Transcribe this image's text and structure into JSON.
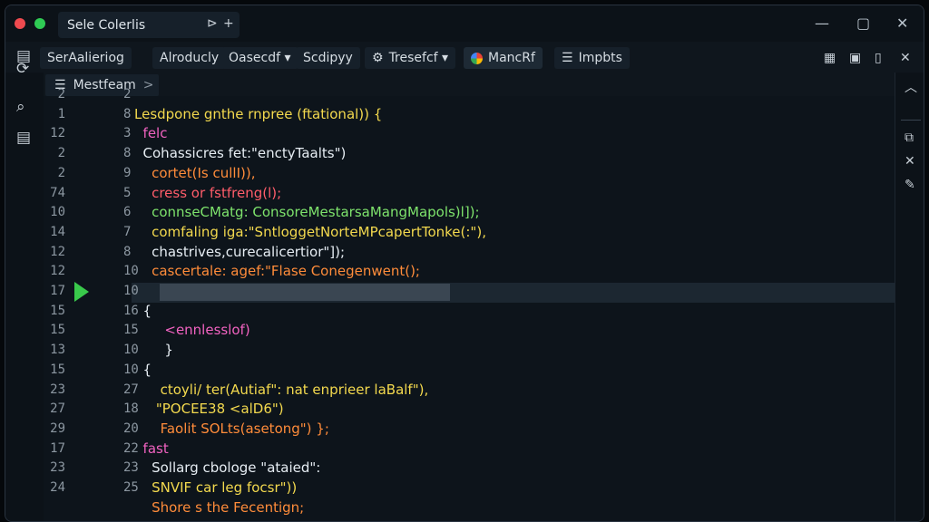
{
  "title_bar": {
    "tab_label": "Sele Colerlis",
    "tab_actions": [
      "⊳",
      "+"
    ],
    "window_controls": [
      "minimize-icon",
      "restore-icon",
      "close-icon"
    ]
  },
  "toolbar": {
    "items": [
      {
        "label": "SerAalieriog",
        "icon": "sidebar-icon"
      },
      {
        "label": "Alroducly"
      },
      {
        "label": "Oasecdf ▾"
      },
      {
        "label": "Scdipyy"
      },
      {
        "label": "Tresefcf ▾",
        "icon": "settings-icon"
      },
      {
        "label": "MancRf",
        "icon": "google-icon",
        "active": true
      },
      {
        "label": "Impbts",
        "icon": "list-icon"
      }
    ],
    "right_icons": [
      "layout-icon",
      "lock-icon",
      "file-icon",
      "close-icon"
    ]
  },
  "activity_bar": {
    "icons": [
      "source-control-icon",
      "search-icon",
      "extensions-icon"
    ]
  },
  "breadcrumb": {
    "label": "Mestfeam",
    "separator": ">"
  },
  "editor": {
    "gutter_left": [
      "2",
      "1",
      "12",
      "2",
      "2",
      "74",
      "10",
      "14",
      "12",
      "12",
      "17",
      "15",
      "15",
      "13",
      "15",
      "23",
      "27",
      "29",
      "17",
      "23",
      "24"
    ],
    "gutter_right": [
      "2",
      "8",
      "3",
      "8",
      "9",
      "5",
      "6",
      "7",
      "8",
      "10",
      "10",
      "16",
      "15",
      "10",
      "10",
      "27",
      "18",
      "20",
      "22",
      "23",
      "25"
    ],
    "current_line": "10",
    "lines": [
      {
        "text": "",
        "color": "white"
      },
      {
        "text": "Lesdpone gnthe rnpree (ftational)) {",
        "color": "yellow"
      },
      {
        "text": "  felc",
        "color": "pink"
      },
      {
        "text": "  Cohassicres fet:\"enctyTaalts\")",
        "color": "white"
      },
      {
        "text": "    cortet(Is cullI)),",
        "color": "orange"
      },
      {
        "text": "    cress or fstfreng(l);",
        "color": "red"
      },
      {
        "text": "    connseCMatg: ConsoreMestarsaMangMapols)l]);",
        "color": "green"
      },
      {
        "text": "    comfaling iga:\"SntloggetNorteMPcapertTonke(:\"),",
        "color": "yellow"
      },
      {
        "text": "    chastrives,curecalicertior\"]);",
        "color": "white"
      },
      {
        "text": "    cascertale: agef:\"Flase Conegenwent();",
        "color": "orange"
      },
      {
        "text": "",
        "color": "white"
      },
      {
        "text": "  {",
        "color": "white"
      },
      {
        "text": "       <ennlesslof)",
        "color": "pink"
      },
      {
        "text": "       }",
        "color": "white"
      },
      {
        "text": "  {",
        "color": "white"
      },
      {
        "text": "      ctoyli/ ter(Autiaf\": nat enprieer laBalf\"),",
        "color": "yellow"
      },
      {
        "text": "     \"POCEE38 <alD6\")",
        "color": "yellow"
      },
      {
        "text": "      Faolit SOLts(asetong\") };",
        "color": "orange"
      },
      {
        "text": "  fast",
        "color": "pink"
      },
      {
        "text": "    Sollarg cbologe \"ataied\":",
        "color": "white"
      },
      {
        "text": "    SNVIF car leg focsr\"))",
        "color": "yellow"
      },
      {
        "text": "    Shore s the Fecentign;",
        "color": "orange"
      }
    ]
  },
  "right_bar": {
    "icons": [
      "chevron-up-icon",
      "minus-icon",
      "copy-icon",
      "close-x-icon",
      "pin-icon"
    ]
  }
}
